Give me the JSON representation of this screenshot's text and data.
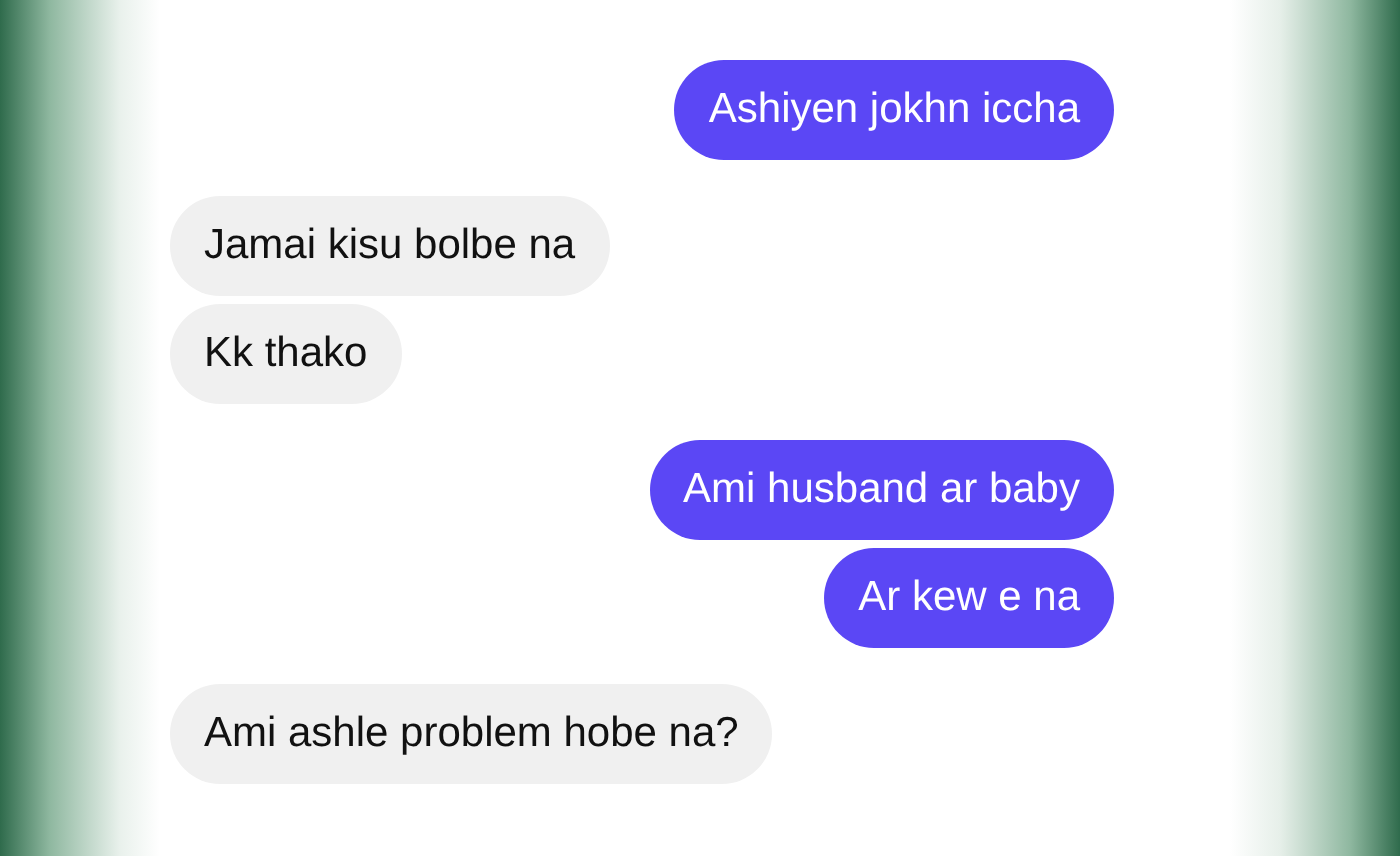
{
  "groups": [
    {
      "kind": "sent",
      "messages": [
        "Ashiyen jokhn iccha"
      ]
    },
    {
      "kind": "received",
      "messages": [
        "Jamai kisu bolbe na",
        "Kk thako"
      ]
    },
    {
      "kind": "sent",
      "messages": [
        "Ami husband ar baby",
        "Ar kew e na"
      ]
    },
    {
      "kind": "received",
      "messages": [
        "Ami ashle problem hobe na?"
      ]
    }
  ]
}
